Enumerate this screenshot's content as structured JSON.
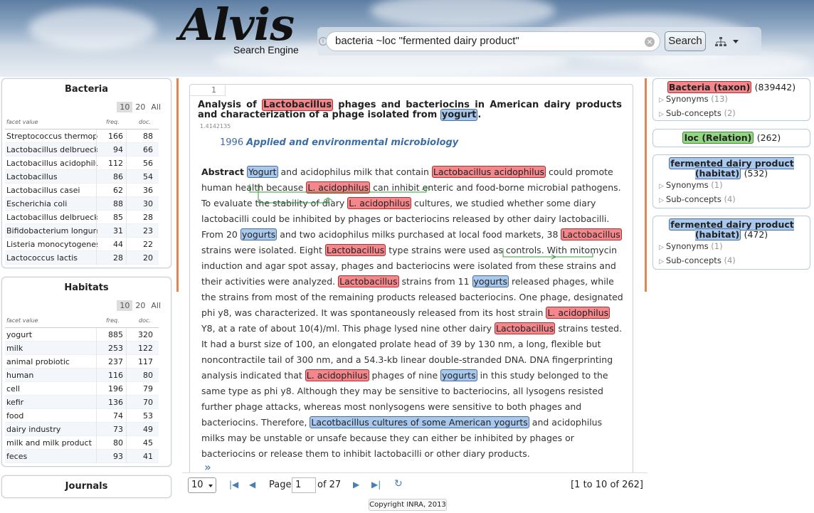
{
  "header": {
    "logo_text": "Alvis",
    "logo_sub": "Search Engine",
    "search_value": "bacteria ~loc \"fermented dairy product\"",
    "search_button": "Search",
    "clear_symbol": "×",
    "info_symbol": "i"
  },
  "facets": [
    {
      "title": "Bacteria",
      "pager": [
        "10",
        "20",
        "All"
      ],
      "col_value": "facet value",
      "col_freq": "freq.",
      "col_doc": "doc.",
      "rows": [
        [
          "Streptococcus thermophi",
          "166",
          "88"
        ],
        [
          "Lactobacillus delbrueckii",
          "94",
          "66"
        ],
        [
          "Lactobacillus acidophilus",
          "112",
          "56"
        ],
        [
          "Lactobacillus",
          "86",
          "54"
        ],
        [
          "Lactobacillus casei",
          "62",
          "36"
        ],
        [
          "Escherichia coli",
          "88",
          "30"
        ],
        [
          "Lactobacillus delbrueckii",
          "85",
          "28"
        ],
        [
          "Bifidobacterium longum",
          "31",
          "23"
        ],
        [
          "Listeria monocytogenes",
          "44",
          "22"
        ],
        [
          "Lactococcus lactis",
          "28",
          "20"
        ]
      ]
    },
    {
      "title": "Habitats",
      "pager": [
        "10",
        "20",
        "All"
      ],
      "col_value": "facet value",
      "col_freq": "freq.",
      "col_doc": "doc.",
      "rows": [
        [
          "yogurt",
          "885",
          "320"
        ],
        [
          "milk",
          "253",
          "122"
        ],
        [
          "animal probiotic",
          "237",
          "117"
        ],
        [
          "human",
          "116",
          "80"
        ],
        [
          "cell",
          "196",
          "79"
        ],
        [
          "kefir",
          "136",
          "70"
        ],
        [
          "food",
          "74",
          "53"
        ],
        [
          "dairy industry",
          "73",
          "49"
        ],
        [
          "milk and milk product",
          "80",
          "45"
        ],
        [
          "feces",
          "93",
          "41"
        ]
      ]
    },
    {
      "title": "Journals"
    }
  ],
  "document": {
    "number": "1",
    "title_parts": [
      [
        "t",
        "Analysis of "
      ],
      [
        "r",
        "Lactobacillus"
      ],
      [
        "t",
        " phages and bacteriocins in American dairy products and characterization of a phage isolated from "
      ],
      [
        "b",
        "yogurt"
      ],
      [
        "t",
        "."
      ]
    ],
    "score": "1.4142135",
    "year": "1996",
    "journal": "Applied and environmental microbiology",
    "abstract_label": "Abstract",
    "abstract_parts": [
      [
        "b",
        "Yogurt"
      ],
      [
        "t",
        " and acidophilus milk that contain "
      ],
      [
        "r",
        "Lactobacillus acidophilus"
      ],
      [
        "t",
        " could promote human health because "
      ],
      [
        "r",
        "L. acidophilus"
      ],
      [
        "t",
        " can inhibit enteric and food-borne microbial pathogens. To evaluate the stability of diary "
      ],
      [
        "r",
        "L. acidophilus"
      ],
      [
        "t",
        " cultures, we studied whether some diary lactobacilli could be inhibited by phages or bacteriocins released by other dairy lactobacilli. From 20 "
      ],
      [
        "b",
        "yogurts"
      ],
      [
        "t",
        " and two acidophilus milks purchased at local food markets, 38 "
      ],
      [
        "r",
        "Lactobacillus"
      ],
      [
        "t",
        " strains were isolated. Eight "
      ],
      [
        "r",
        "Lactobacillus"
      ],
      [
        "t",
        " type strains were used as controls. With mitomycin induction and agar spot assay, phages and bacteriocins were isolated from these strains and their activities were analyzed. "
      ],
      [
        "r",
        "Lactobacillus"
      ],
      [
        "t",
        " strains from 11 "
      ],
      [
        "b",
        "yogurts"
      ],
      [
        "t",
        " released phages, while the strains from most of the remaining products released bacteriocins. One phage, designated phi y8, was characterized. It was spontaneously released from its host strain "
      ],
      [
        "r",
        "L. acidophilus"
      ],
      [
        "t",
        " Y8, at a rate of about 10(4)/ml. This phage lysed nine other dairy "
      ],
      [
        "r",
        "Lactobacillus"
      ],
      [
        "t",
        " strains tested. It had a burst size of 100, an elongated prolate head of 39 by 130 nm, a long, flexible but noncontractile tail of 300 nm, and a 54.3-kb linear double-stranded DNA. DNA fingerprinting analysis indicated that "
      ],
      [
        "r",
        "L. acidophilus"
      ],
      [
        "t",
        " phages of nine "
      ],
      [
        "b",
        "yogurts"
      ],
      [
        "t",
        " in this study belonged to the same type as phi y8. Although they may be sensitive to bacteriocins, all lysogens resisted further phage attacks, whereas most nonlysogens were sensitive to both phages and bacteriocins. Therefore, "
      ],
      [
        "b",
        "Lacotbacillus cultures of some American yogurts"
      ],
      [
        "t",
        " and acidophilus milks may be unstable or unsafe because they can either be inhibited by phages or bacteriocins or release them to inhibit lactobacilli or other diary products."
      ]
    ],
    "expand_symbol": "»"
  },
  "pager": {
    "size": "10",
    "page_label": "Page",
    "page_value": "1",
    "of_label": "of 27",
    "range": "[1 to 10 of 262]"
  },
  "concepts": [
    {
      "title": "Bacteria (taxon)",
      "style": "r",
      "count": "(839442)",
      "subs": [
        [
          "Synonyms",
          "(13)"
        ],
        [
          "Sub-concepts",
          "(2)"
        ]
      ]
    },
    {
      "title": "loc (Relation)",
      "style": "g",
      "count": "(262)",
      "subs": []
    },
    {
      "title": "fermented dairy product (habitat)",
      "style": "b",
      "count": "(532)",
      "subs": [
        [
          "Synonyms",
          "(1)"
        ],
        [
          "Sub-concepts",
          "(4)"
        ]
      ]
    },
    {
      "title": "fermented dairy product (habitat)",
      "style": "b",
      "count": "(472)",
      "subs": [
        [
          "Synonyms",
          "(1)"
        ],
        [
          "Sub-concepts",
          "(4)"
        ]
      ]
    }
  ],
  "copyright": "Copyright INRA, 2013",
  "colors": {
    "accent": "#e8834e",
    "taxon": "#f4878c",
    "habitat": "#a9c8ee",
    "relation": "#92d582",
    "link": "#3b6ea5"
  }
}
